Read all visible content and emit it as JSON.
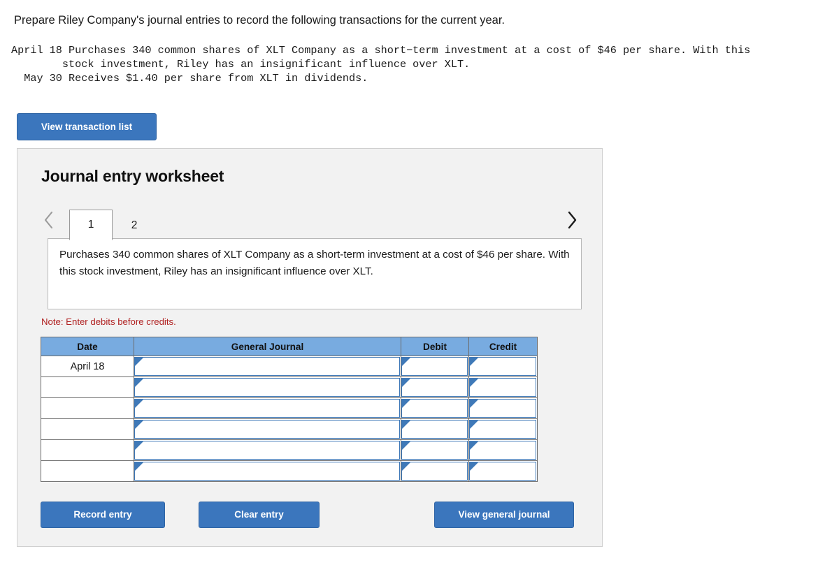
{
  "prompt": {
    "heading": "Prepare Riley Company's journal entries to record the following transactions for the current year.",
    "transactions_block": "April 18 Purchases 340 common shares of XLT Company as a short−term investment at a cost of $46 per share. With this\n        stock investment, Riley has an insignificant influence over XLT.\n  May 30 Receives $1.40 per share from XLT in dividends."
  },
  "toolbar": {
    "view_transaction_list_label": "View transaction list"
  },
  "worksheet": {
    "title": "Journal entry worksheet",
    "prev_icon": "chevron-left-icon",
    "next_icon": "chevron-right-icon",
    "tabs": [
      {
        "label": "1",
        "active": true
      },
      {
        "label": "2",
        "active": false
      }
    ],
    "description": "Purchases 340 common shares of XLT Company as a short-term investment at a cost of $46 per share. With this stock investment, Riley has an insignificant influence over XLT.",
    "note": "Note: Enter debits before credits.",
    "table": {
      "columns": [
        "Date",
        "General Journal",
        "Debit",
        "Credit"
      ],
      "rows": [
        {
          "date": "April 18",
          "general_journal": "",
          "debit": "",
          "credit": ""
        },
        {
          "date": "",
          "general_journal": "",
          "debit": "",
          "credit": ""
        },
        {
          "date": "",
          "general_journal": "",
          "debit": "",
          "credit": ""
        },
        {
          "date": "",
          "general_journal": "",
          "debit": "",
          "credit": ""
        },
        {
          "date": "",
          "general_journal": "",
          "debit": "",
          "credit": ""
        },
        {
          "date": "",
          "general_journal": "",
          "debit": "",
          "credit": ""
        }
      ]
    },
    "buttons": {
      "record_entry": "Record entry",
      "clear_entry": "Clear entry",
      "view_general_journal": "View general journal"
    }
  },
  "colors": {
    "button_blue": "#3b76bd",
    "table_header_blue": "#78abe0",
    "field_border_blue": "#3f79b8",
    "note_red": "#b02020",
    "card_background": "#f2f2f2"
  }
}
